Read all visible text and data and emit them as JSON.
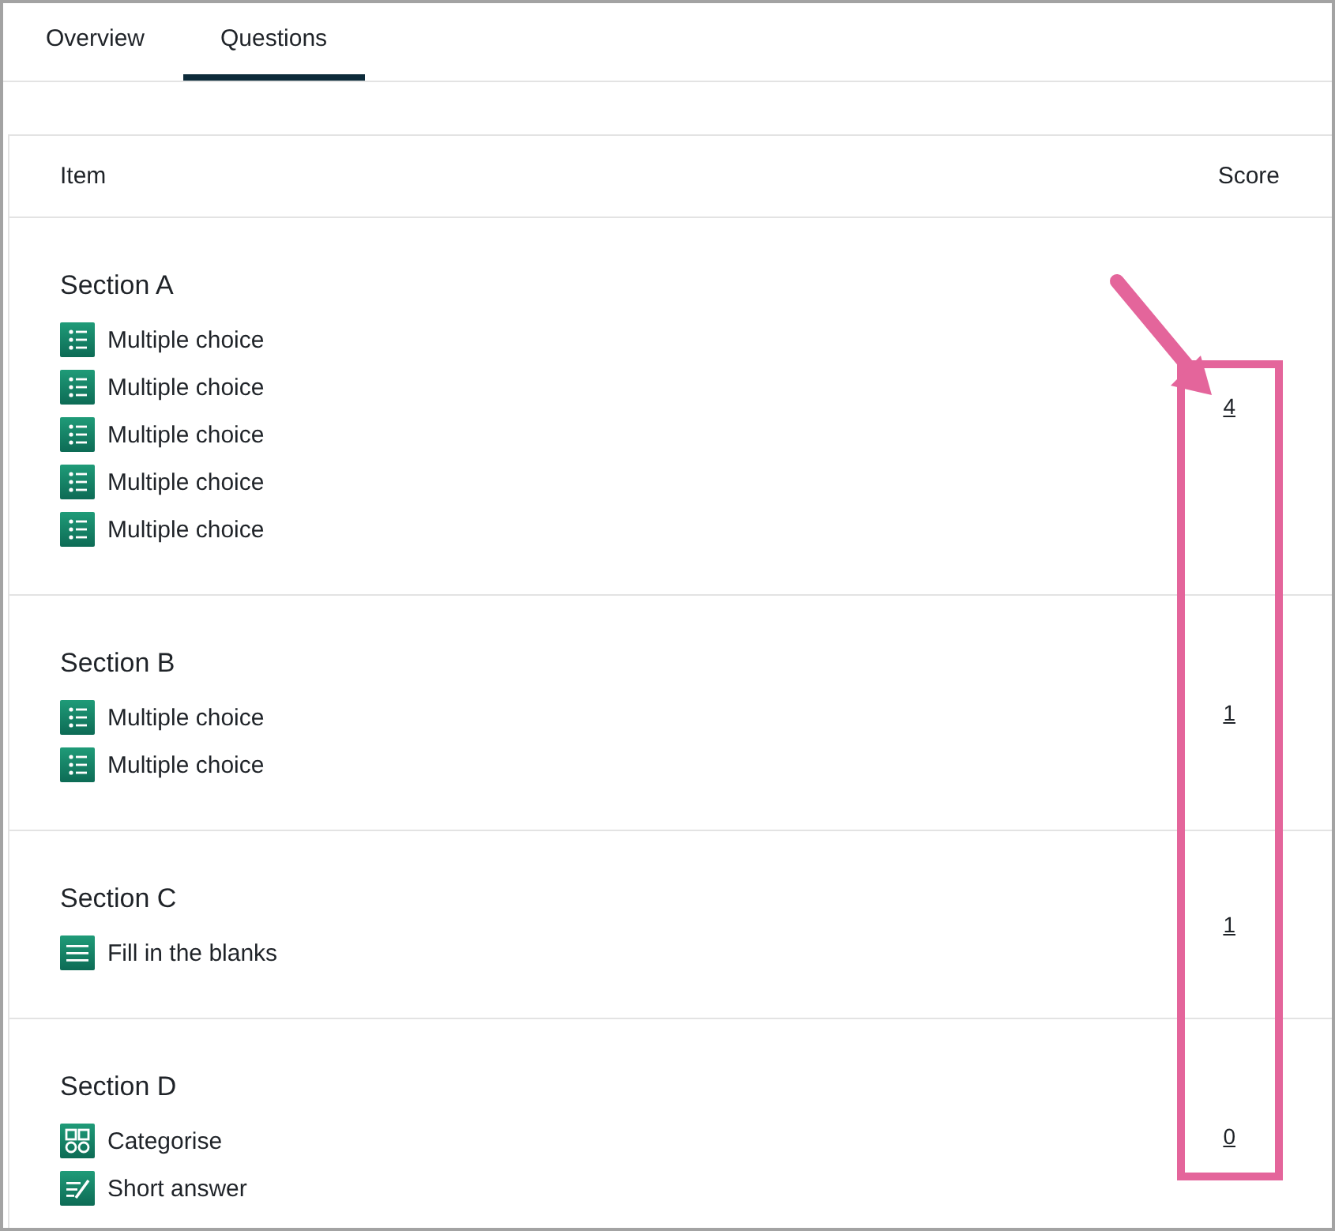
{
  "tabs": [
    {
      "label": "Overview",
      "selected": false
    },
    {
      "label": "Questions",
      "selected": true
    }
  ],
  "table": {
    "columns": [
      "Item",
      "Score"
    ],
    "sections": [
      {
        "title": "Section A",
        "score": "4",
        "items": [
          {
            "kind": "multiple-choice",
            "label": "Multiple choice"
          },
          {
            "kind": "multiple-choice",
            "label": "Multiple choice"
          },
          {
            "kind": "multiple-choice",
            "label": "Multiple choice"
          },
          {
            "kind": "multiple-choice",
            "label": "Multiple choice"
          },
          {
            "kind": "multiple-choice",
            "label": "Multiple choice"
          }
        ]
      },
      {
        "title": "Section B",
        "score": "1",
        "items": [
          {
            "kind": "multiple-choice",
            "label": "Multiple choice"
          },
          {
            "kind": "multiple-choice",
            "label": "Multiple choice"
          }
        ]
      },
      {
        "title": "Section C",
        "score": "1",
        "items": [
          {
            "kind": "fill-blanks",
            "label": "Fill in the blanks"
          }
        ]
      },
      {
        "title": "Section D",
        "score": "0",
        "items": [
          {
            "kind": "categorise",
            "label": "Categorise"
          },
          {
            "kind": "short-answer",
            "label": "Short answer"
          }
        ]
      }
    ]
  }
}
